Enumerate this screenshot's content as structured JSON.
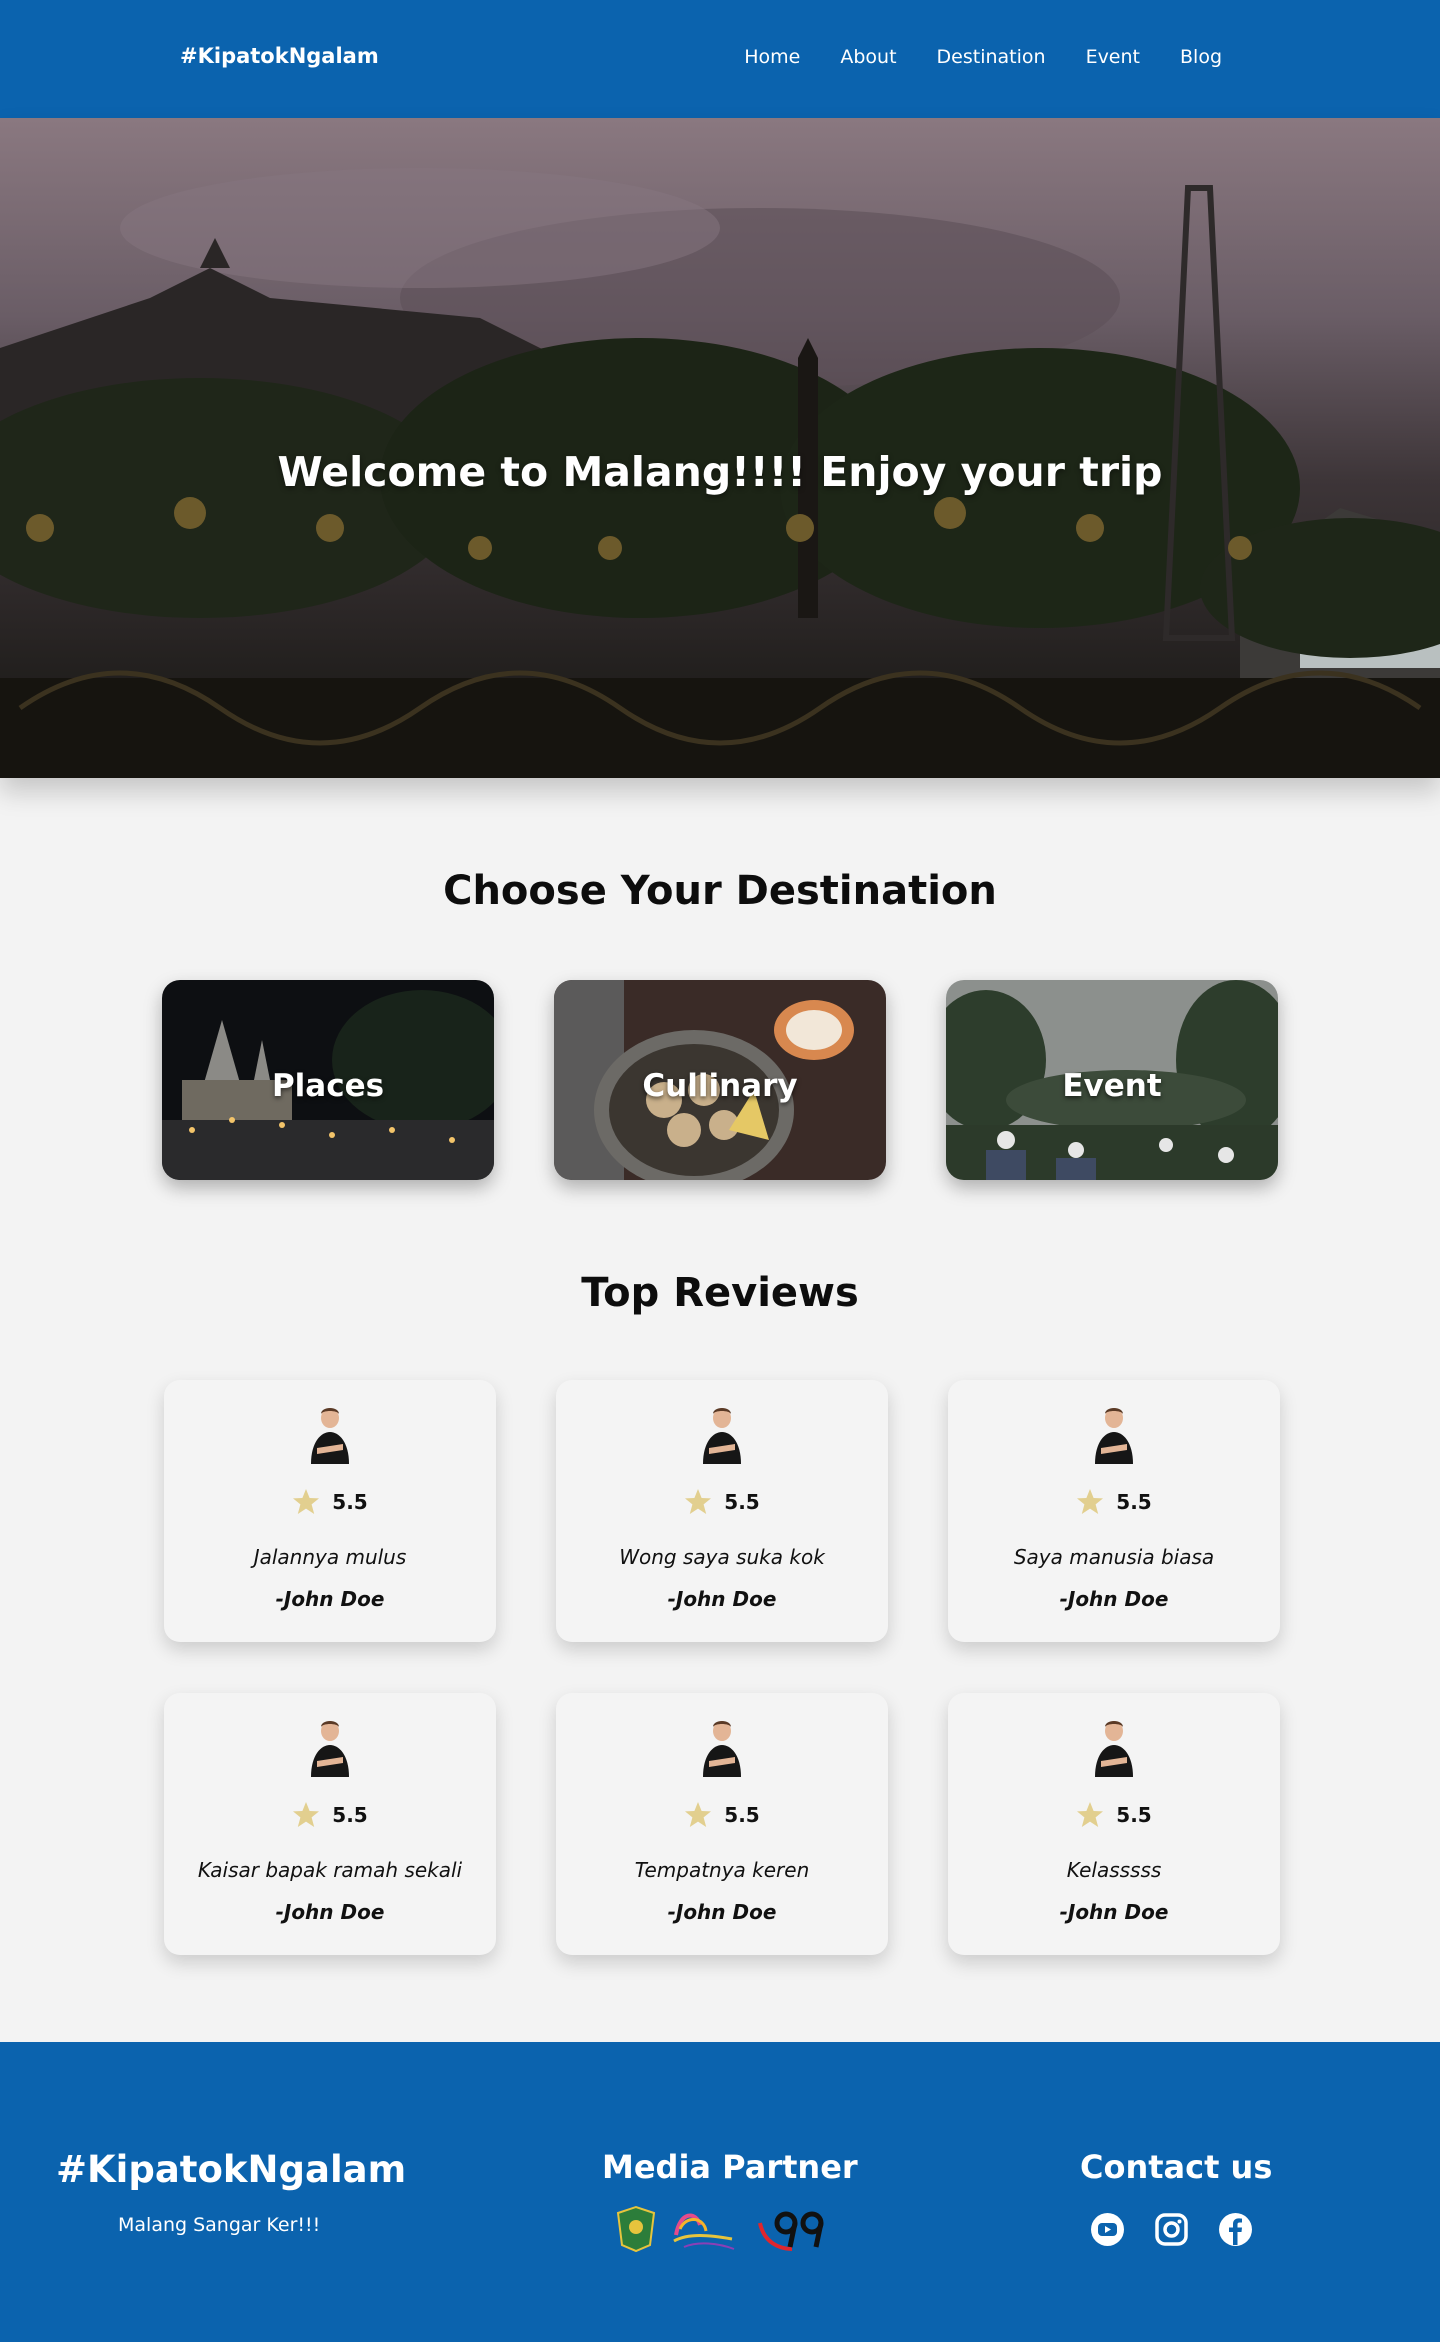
{
  "header": {
    "brand": "#KipatokNgalam",
    "nav": [
      "Home",
      "About",
      "Destination",
      "Event",
      "Blog"
    ]
  },
  "hero": {
    "title": "Welcome to Malang!!!! Enjoy your trip"
  },
  "destinations": {
    "title": "Choose Your Destination",
    "items": [
      {
        "label": "Places"
      },
      {
        "label": "Cullinary"
      },
      {
        "label": "Event"
      }
    ]
  },
  "reviews": {
    "title": "Top Reviews",
    "items": [
      {
        "rating": "5.5",
        "text": "Jalannya mulus",
        "author": "-John Doe"
      },
      {
        "rating": "5.5",
        "text": "Wong saya suka kok",
        "author": "-John Doe"
      },
      {
        "rating": "5.5",
        "text": "Saya manusia biasa",
        "author": "-John Doe"
      },
      {
        "rating": "5.5",
        "text": "Kaisar bapak ramah sekali",
        "author": "-John Doe"
      },
      {
        "rating": "5.5",
        "text": "Tempatnya keren",
        "author": "-John Doe"
      },
      {
        "rating": "5.5",
        "text": "Kelasssss",
        "author": "-John Doe"
      }
    ]
  },
  "footer": {
    "brand": "#KipatokNgalam",
    "tagline": "Malang Sangar Ker!!!",
    "media_title": "Media Partner",
    "media_logos": [
      "malang-city-emblem",
      "beautiful-malang-logo",
      "99-logo"
    ],
    "contact_title": "Contact us",
    "social_icons": [
      "youtube-icon",
      "instagram-icon",
      "facebook-icon"
    ]
  },
  "colors": {
    "primary": "#0b63ae",
    "background": "#f3f3f3",
    "star": "#e2cf8f"
  }
}
